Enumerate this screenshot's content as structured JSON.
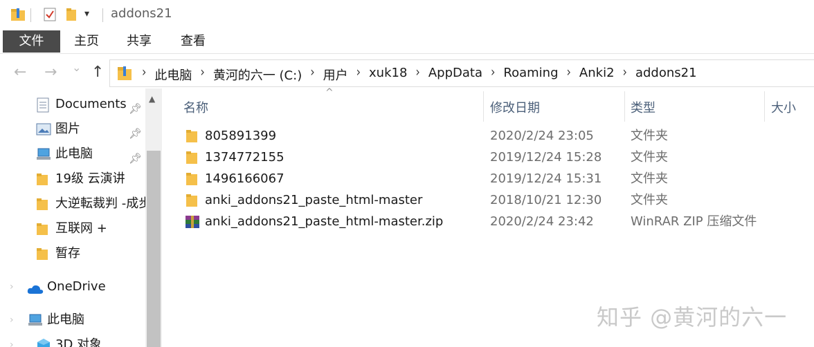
{
  "window": {
    "title": "addons21"
  },
  "ribbon": {
    "tabs": [
      "文件",
      "主页",
      "共享",
      "查看"
    ]
  },
  "nav_buttons": {
    "back": "←",
    "forward": "→",
    "recent": "⌄",
    "up": "↑"
  },
  "address": {
    "crumbs": [
      "此电脑",
      "黄河的六一 (C:)",
      "用户",
      "xuk18",
      "AppData",
      "Roaming",
      "Anki2",
      "addons21"
    ]
  },
  "sidebar": {
    "items": [
      {
        "label": "Documents",
        "icon": "document-icon",
        "pinned": true
      },
      {
        "label": "图片",
        "icon": "pictures-icon",
        "pinned": true
      },
      {
        "label": "此电脑",
        "icon": "computer-icon",
        "pinned": true
      },
      {
        "label": "19级 云演讲",
        "icon": "folder-icon",
        "pinned": false
      },
      {
        "label": "大逆転裁判 -成步",
        "icon": "folder-icon",
        "pinned": false
      },
      {
        "label": "互联网 +",
        "icon": "folder-icon",
        "pinned": false
      },
      {
        "label": "暂存",
        "icon": "folder-icon",
        "pinned": false
      },
      {
        "label": "OneDrive",
        "icon": "cloud-icon",
        "pinned": false
      },
      {
        "label": "此电脑",
        "icon": "computer-icon",
        "pinned": false
      },
      {
        "label": "3D 对象",
        "icon": "3d-objects-icon",
        "pinned": false
      }
    ]
  },
  "columns": {
    "name": "名称",
    "modified": "修改日期",
    "type": "类型",
    "size": "大小"
  },
  "files": [
    {
      "name": "805891399",
      "modified": "2020/2/24 23:05",
      "type": "文件夹",
      "icon": "folder-icon"
    },
    {
      "name": "1374772155",
      "modified": "2019/12/24 15:28",
      "type": "文件夹",
      "icon": "folder-icon"
    },
    {
      "name": "1496166067",
      "modified": "2019/12/24 15:31",
      "type": "文件夹",
      "icon": "folder-icon"
    },
    {
      "name": "anki_addons21_paste_html-master",
      "modified": "2018/10/21 12:30",
      "type": "文件夹",
      "icon": "folder-icon"
    },
    {
      "name": "anki_addons21_paste_html-master.zip",
      "modified": "2020/2/24 23:42",
      "type": "WinRAR ZIP 压缩文件",
      "icon": "winrar-archive-icon"
    }
  ],
  "watermark": "知乎 @黄河的六一",
  "colors": {
    "folder": "#f5c04a",
    "file_tab": "#4a4a4a",
    "header_text": "#4c607a"
  }
}
